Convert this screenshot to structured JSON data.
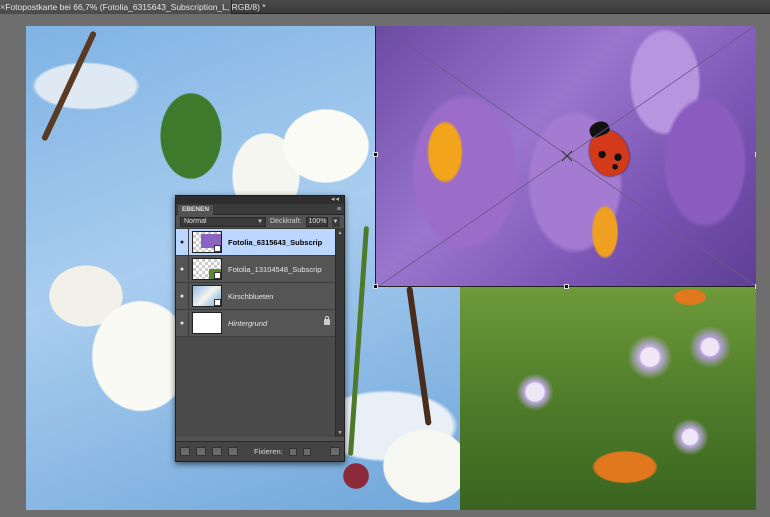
{
  "document": {
    "tab_title": "Fotopostkarte bei 66,7% (Fotolia_6315643_Subscription_L, RGB/8) *",
    "close_glyph": "×"
  },
  "canvas": {
    "images": [
      {
        "name": "cherry-blossom",
        "description_icon": "cherry-blossom-photo"
      },
      {
        "name": "crocus-ladybug",
        "description_icon": "crocus-photo"
      },
      {
        "name": "meadow-butterflies",
        "description_icon": "meadow-photo"
      }
    ]
  },
  "layers_panel": {
    "tab_label": "EBENEN",
    "menu_glyph": "≡",
    "grip_glyph": "◂◂",
    "blend_mode": "Normal",
    "opacity_label": "Deckkraft:",
    "opacity_value": "100%",
    "layers": [
      {
        "name": "Fotolia_6315643_Subscripti...",
        "selected": true,
        "thumb": "crocus-thumb"
      },
      {
        "name": "Fotolia_13104548_Subscriptio...",
        "selected": false,
        "thumb": "meadow-thumb"
      },
      {
        "name": "Kirschblueten",
        "selected": false,
        "thumb": "cherry-thumb"
      },
      {
        "name": "Hintergrund",
        "selected": false,
        "thumb": "white-thumb",
        "locked": true
      }
    ],
    "eye_glyph": "●",
    "footer": {
      "fix_label": "Fixieren:"
    }
  },
  "colors": {
    "selection": "#bcd7ff",
    "panel_bg": "#535353",
    "app_bg": "#6e6e6e"
  }
}
